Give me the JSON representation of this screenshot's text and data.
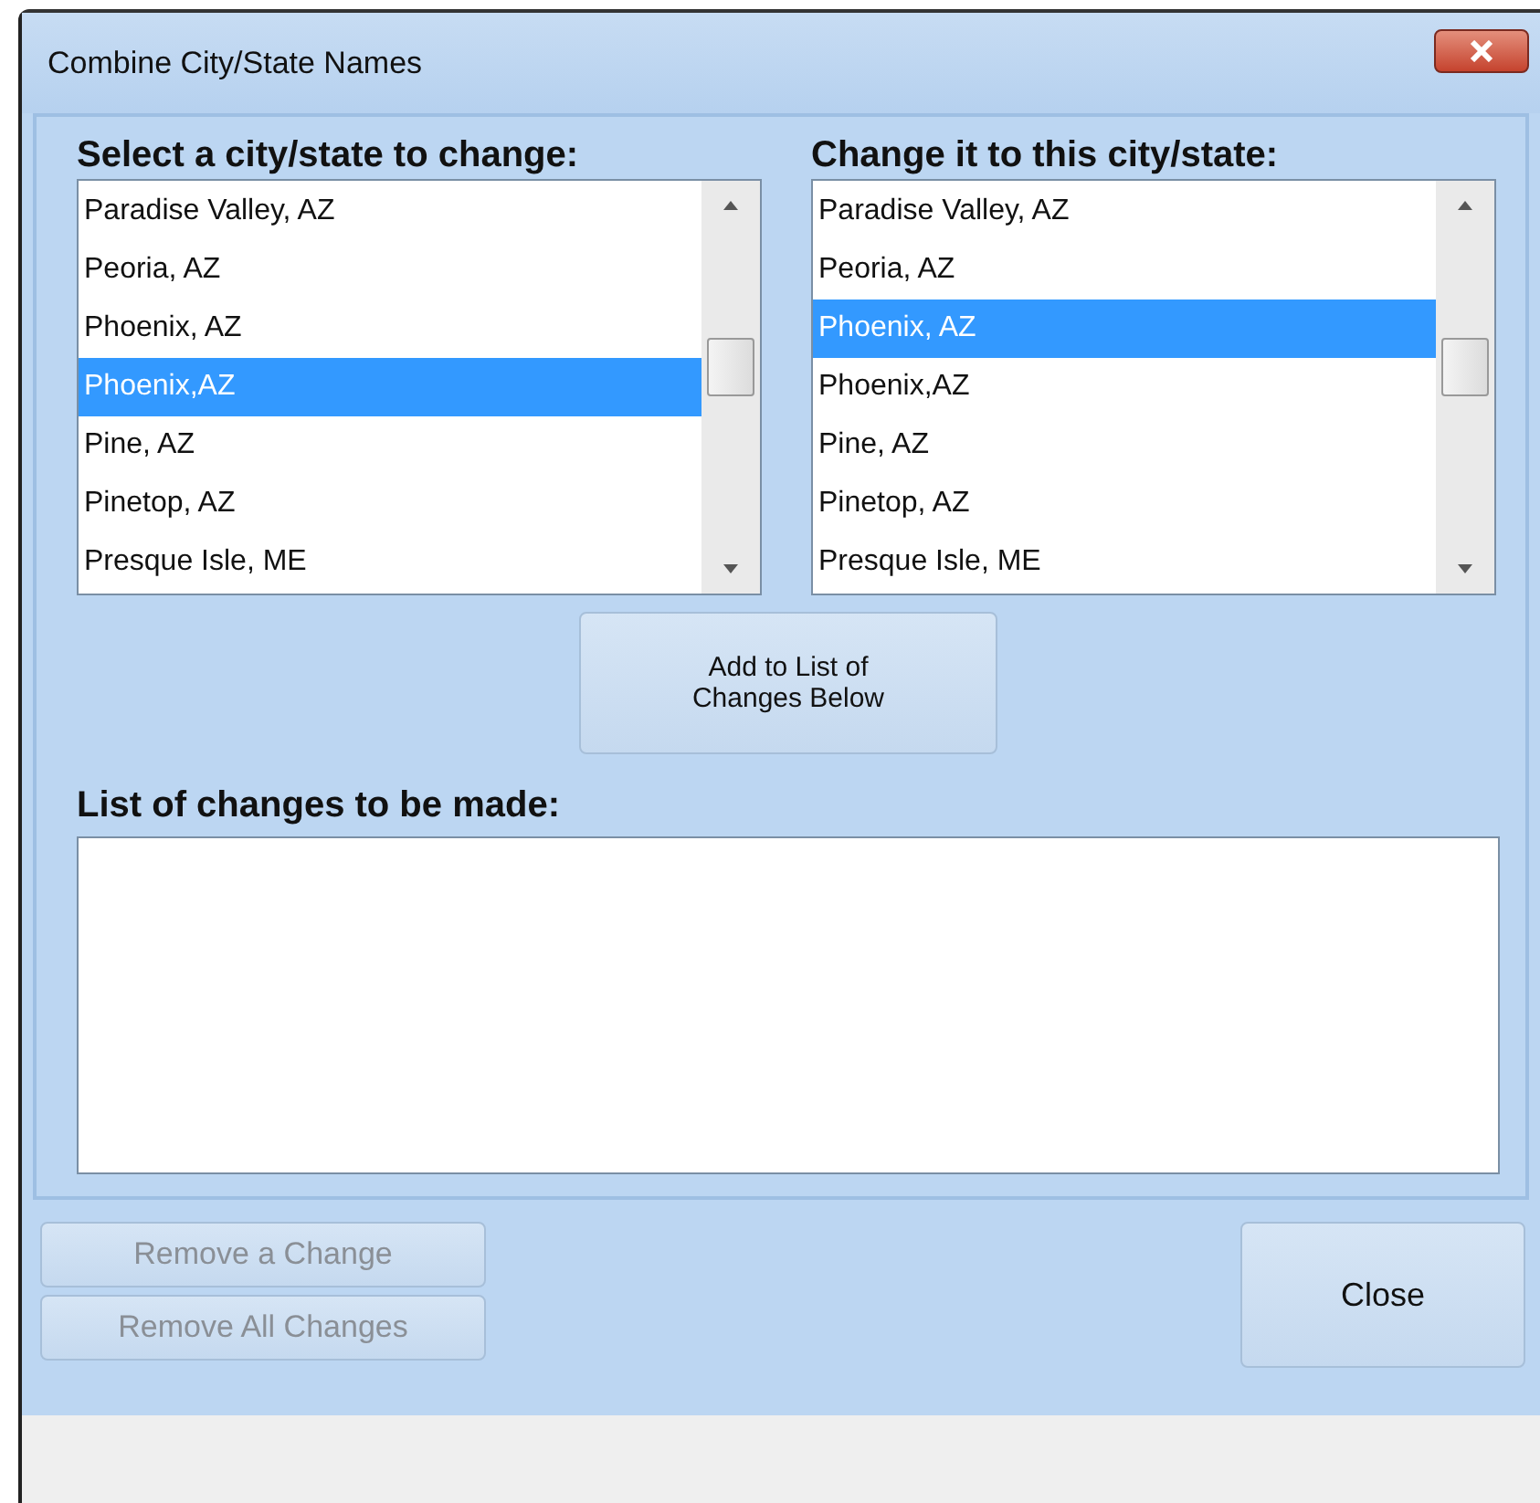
{
  "window": {
    "title": "Combine City/State Names"
  },
  "source_list": {
    "label": "Select a city/state to change:",
    "items": [
      {
        "text": "Paradise Valley, AZ",
        "selected": false
      },
      {
        "text": "Peoria, AZ",
        "selected": false
      },
      {
        "text": "Phoenix, AZ",
        "selected": false
      },
      {
        "text": "Phoenix,AZ",
        "selected": true
      },
      {
        "text": "Pine, AZ",
        "selected": false
      },
      {
        "text": "Pinetop, AZ",
        "selected": false
      },
      {
        "text": "Presque Isle, ME",
        "selected": false
      }
    ]
  },
  "target_list": {
    "label": "Change it to this city/state:",
    "items": [
      {
        "text": "Paradise Valley, AZ",
        "selected": false
      },
      {
        "text": "Peoria, AZ",
        "selected": false
      },
      {
        "text": "Phoenix, AZ",
        "selected": true
      },
      {
        "text": "Phoenix,AZ",
        "selected": false
      },
      {
        "text": "Pine, AZ",
        "selected": false
      },
      {
        "text": "Pinetop, AZ",
        "selected": false
      },
      {
        "text": "Presque Isle, ME",
        "selected": false
      }
    ]
  },
  "add_button": {
    "label": "Add to List of\nChanges Below"
  },
  "changes": {
    "label": "List of changes to be made:"
  },
  "buttons": [
    {
      "label": "Remove a Change",
      "disabled": true
    },
    {
      "label": "Remove All Changes",
      "disabled": true
    }
  ],
  "close_button": {
    "label": "Close"
  }
}
